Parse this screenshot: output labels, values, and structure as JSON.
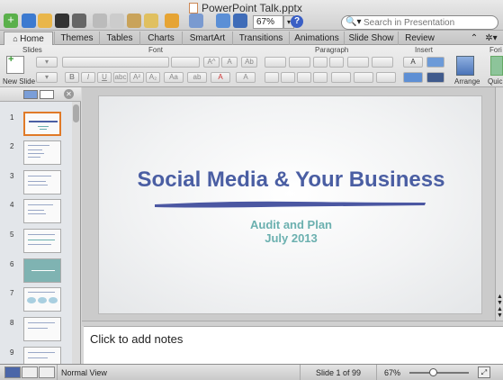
{
  "window": {
    "title": "PowerPoint Talk.pptx"
  },
  "toolbar": {
    "zoom": "67%",
    "search_placeholder": "Search in Presentation"
  },
  "tabs": [
    "Home",
    "Themes",
    "Tables",
    "Charts",
    "SmartArt",
    "Transitions",
    "Animations",
    "Slide Show",
    "Review"
  ],
  "ribbon": {
    "groups": {
      "slides": "Slides",
      "font": "Font",
      "paragraph": "Paragraph",
      "insert": "Insert",
      "format": "Fori"
    },
    "new_slide": "New Slide",
    "arrange": "Arrange",
    "quick": "Quic"
  },
  "slides": {
    "numbers": [
      "1",
      "2",
      "3",
      "4",
      "5",
      "6",
      "7",
      "8",
      "9"
    ]
  },
  "current_slide": {
    "title": "Social Media & Your Business",
    "subtitle1": "Audit and Plan",
    "subtitle2": "July 2013"
  },
  "notes": {
    "placeholder": "Click to add notes"
  },
  "status": {
    "view": "Normal View",
    "slide_counter": "Slide 1 of 99",
    "zoom": "67%",
    "zoom_level": 0.4
  },
  "colors": {
    "title": "#4a5ea3",
    "subtitle": "#6bb0af",
    "selection": "#e07a28"
  }
}
